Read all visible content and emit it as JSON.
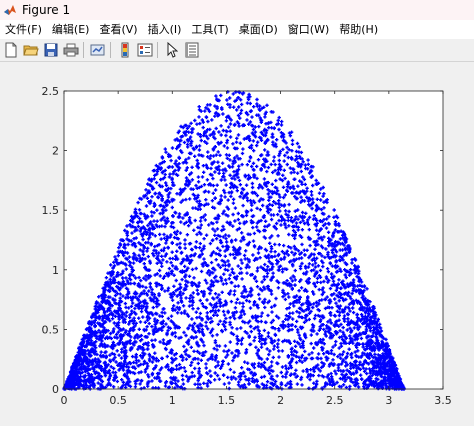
{
  "window": {
    "title": "Figure 1"
  },
  "menu": {
    "items": [
      "文件(F)",
      "编辑(E)",
      "查看(V)",
      "插入(I)",
      "工具(T)",
      "桌面(D)",
      "窗口(W)",
      "帮助(H)"
    ]
  },
  "toolbar": {
    "icons": [
      "new-figure-icon",
      "open-file-icon",
      "save-icon",
      "print-icon",
      "link-plot-icon",
      "colorbar-icon",
      "legend-icon",
      "edit-plot-icon",
      "property-inspector-icon"
    ]
  },
  "colors": {
    "points": "#0000ff",
    "axes_bg": "#ffffff",
    "figure_bg": "#f0f0f0"
  },
  "chart_data": {
    "type": "scatter",
    "title": "",
    "xlabel": "",
    "ylabel": "",
    "xlim": [
      0,
      3.5
    ],
    "ylim": [
      0,
      2.5
    ],
    "xticks": [
      0,
      0.5,
      1,
      1.5,
      2,
      2.5,
      3,
      3.5
    ],
    "xtick_labels": [
      "0",
      "0.5",
      "1",
      "1.5",
      "2",
      "2.5",
      "3",
      "3.5"
    ],
    "yticks": [
      0,
      0.5,
      1,
      1.5,
      2,
      2.5
    ],
    "ytick_labels": [
      "0",
      "0.5",
      "1",
      "1.5",
      "2",
      "2.5"
    ],
    "region": {
      "x_range": [
        0,
        3.1416
      ],
      "upper_boundary": "2.5*sin(x)",
      "lower_boundary": "0"
    },
    "marker_color": "#0000ff",
    "grid": false,
    "box": true
  }
}
